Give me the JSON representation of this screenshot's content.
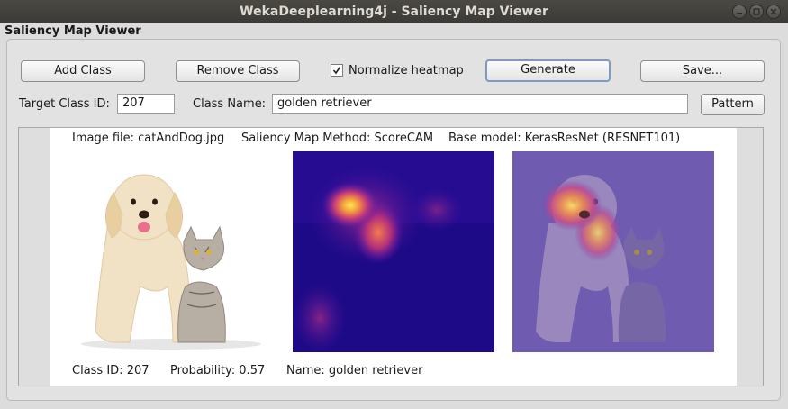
{
  "window": {
    "title": "WekaDeeplearning4j - Saliency Map Viewer"
  },
  "menubar": {
    "label": "Saliency Map Viewer"
  },
  "toolbar": {
    "add_class": "Add Class",
    "remove_class": "Remove Class",
    "normalize": {
      "label": "Normalize heatmap",
      "checked": true
    },
    "generate": "Generate",
    "save": "Save..."
  },
  "target": {
    "class_id_label": "Target Class ID:",
    "class_id_value": "207",
    "class_name_label": "Class Name:",
    "class_name_value": "golden retriever",
    "pattern": "Pattern"
  },
  "result": {
    "image_file": "Image file: catAndDog.jpg",
    "method": "Saliency Map Method: ScoreCAM",
    "base_model": "Base model: KerasResNet (RESNET101)",
    "class_id": "Class ID: 207",
    "probability": "Probability: 0.57",
    "name": "Name: golden retriever"
  },
  "icons": {
    "minimize": "minimize-icon",
    "maximize": "maximize-icon",
    "close": "close-icon",
    "check": "checkmark-icon"
  }
}
